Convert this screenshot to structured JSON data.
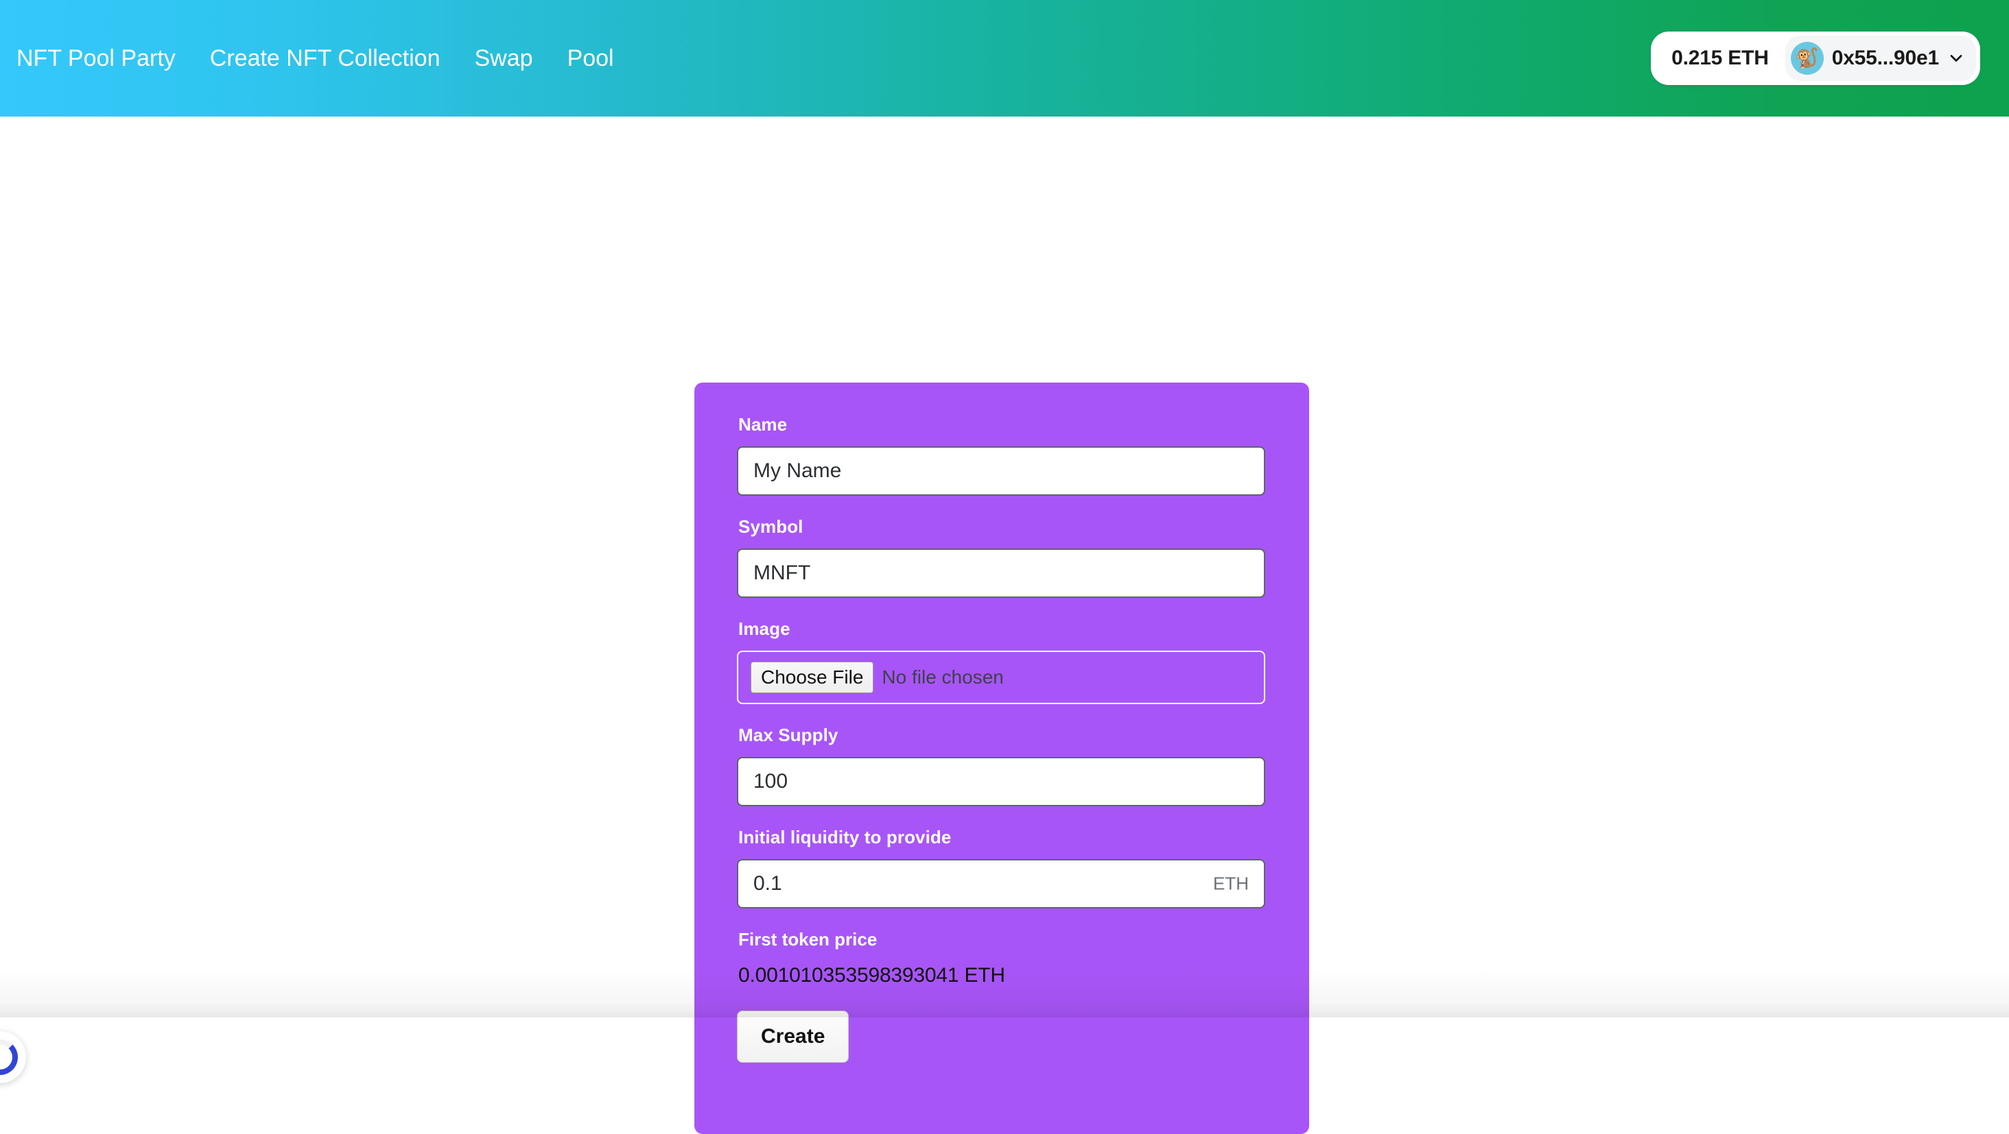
{
  "navbar": {
    "links": [
      {
        "label": "NFT Pool Party",
        "name": "nav-link-nft-pool-party"
      },
      {
        "label": "Create NFT Collection",
        "name": "nav-link-create-nft-collection"
      },
      {
        "label": "Swap",
        "name": "nav-link-swap"
      },
      {
        "label": "Pool",
        "name": "nav-link-pool"
      }
    ],
    "gradient_start": "#35c8fb",
    "gradient_end": "#0ea24e"
  },
  "wallet": {
    "balance": "0.215 ETH",
    "address": "0x55...90e1",
    "avatar_glyph": "🐒",
    "chevron": "chevron-down-icon"
  },
  "form": {
    "card_color": "#a855f7",
    "name": {
      "label": "Name",
      "value": "My Name",
      "placeholder": "Name"
    },
    "symbol": {
      "label": "Symbol",
      "value": "MNFT",
      "placeholder": "Symbol"
    },
    "image": {
      "label": "Image",
      "button_label": "Choose File",
      "status": "No file chosen"
    },
    "max_supply": {
      "label": "Max Supply",
      "value": "100",
      "placeholder": "Max Supply"
    },
    "initial_liquidity": {
      "label": "Initial liquidity to provide",
      "value": "0.1",
      "placeholder": "0.0",
      "suffix": "ETH"
    },
    "first_token_price": {
      "label": "First token price",
      "value": "0.001010353598393041 ETH"
    },
    "submit_label": "Create"
  },
  "spinner": {
    "name": "loading-spinner",
    "color": "#3244d4"
  }
}
